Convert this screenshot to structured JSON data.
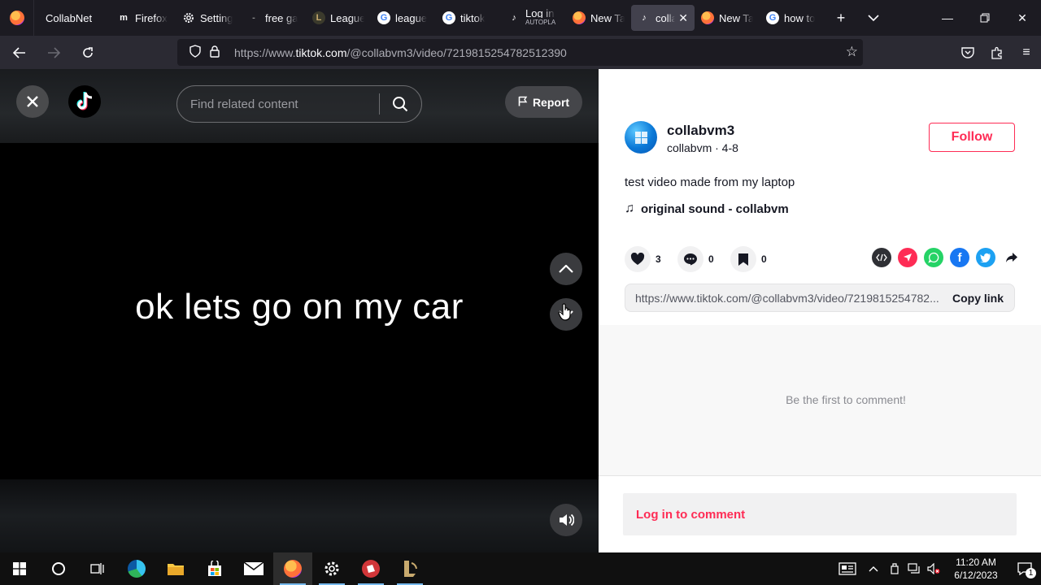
{
  "browser": {
    "tabs": [
      {
        "label": "CollabNet",
        "icon": "collabnet-icon"
      },
      {
        "label": "Firefox",
        "icon": "m-icon"
      },
      {
        "label": "Setting",
        "icon": "gear-icon"
      },
      {
        "label": "free ga",
        "icon": "dash-icon"
      },
      {
        "label": "League",
        "icon": "league-icon"
      },
      {
        "label": "league",
        "icon": "google-icon"
      },
      {
        "label": "tiktok",
        "icon": "google-icon"
      },
      {
        "label": "Log in",
        "sublabel": "AUTOPLA",
        "icon": "tiktok-icon"
      },
      {
        "label": "New Ta",
        "icon": "firefox-icon"
      },
      {
        "label": "colla",
        "icon": "tiktok-icon",
        "active": true
      },
      {
        "label": "New Ta",
        "icon": "firefox-icon"
      },
      {
        "label": "how to",
        "icon": "google-icon"
      }
    ],
    "url_prefix": "https://www.",
    "url_domain": "tiktok.com",
    "url_path": "/@collabvm3/video/7219815254782512390"
  },
  "video": {
    "search_placeholder": "Find related content",
    "report_label": "Report",
    "caption": "ok lets go on my car"
  },
  "post": {
    "username": "collabvm3",
    "meta": "collabvm · 4-8",
    "follow_label": "Follow",
    "description": "test video made from my laptop",
    "sound": "original sound - collabvm",
    "likes": "3",
    "comments": "0",
    "saves": "0",
    "share_link": "https://www.tiktok.com/@collabvm3/video/7219815254782...",
    "copy_link_label": "Copy link",
    "empty_comments": "Be the first to comment!",
    "login_to_comment": "Log in to comment"
  },
  "taskbar": {
    "time": "11:20 AM",
    "date": "6/12/2023",
    "notifications": "1"
  },
  "colors": {
    "tiktok_red": "#fe2c55",
    "firefox_tabstrip": "#1c1b22",
    "firefox_toolbar": "#2b2a33"
  }
}
